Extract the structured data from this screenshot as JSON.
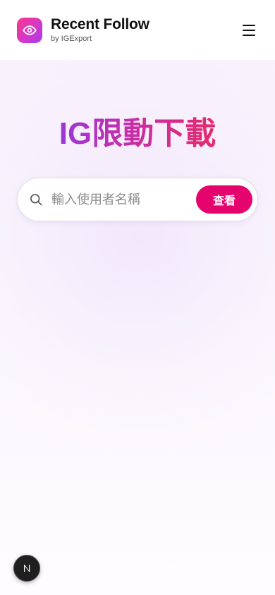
{
  "header": {
    "brand_title": "Recent Follow",
    "brand_subtitle": "by IGExport",
    "logo_icon": "eye-icon",
    "menu_icon": "hamburger-menu-icon"
  },
  "hero": {
    "title": "IG限動下載"
  },
  "search": {
    "placeholder": "輸入使用者名稱",
    "value": "",
    "button_label": "查看",
    "icon": "search-icon"
  },
  "dev_badge": {
    "letter": "N",
    "icon": "nextjs-logo-icon"
  },
  "colors": {
    "accent": "#e5046e",
    "logo_gradient_start": "#f7398c",
    "logo_gradient_end": "#a43df0",
    "title_gradient_start": "#9b37d6",
    "title_gradient_end": "#e62a6b"
  }
}
